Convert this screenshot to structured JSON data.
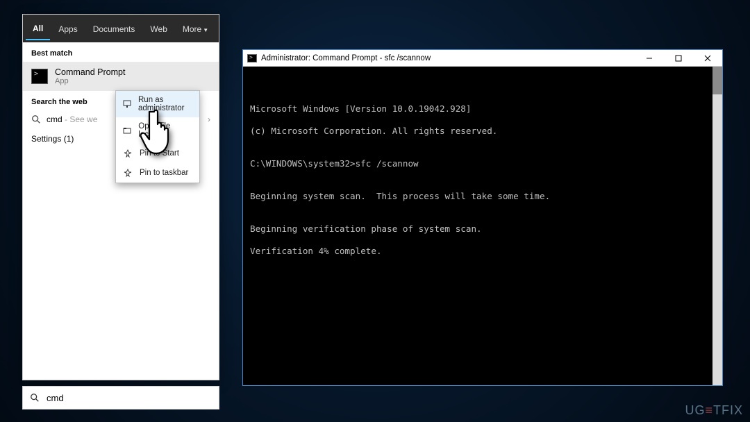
{
  "search_panel": {
    "tabs": {
      "all": "All",
      "apps": "Apps",
      "documents": "Documents",
      "web": "Web",
      "more": "More"
    },
    "best_match_label": "Best match",
    "primary_result": {
      "title": "Command Prompt",
      "subtitle": "App"
    },
    "web_section_label": "Search the web",
    "web_query": "cmd",
    "web_hint": " - See we",
    "settings_row": "Settings (1)"
  },
  "context_menu": {
    "run_admin": "Run as administrator",
    "open_location": "Open file location",
    "pin_start": "Pin to Start",
    "pin_taskbar": "Pin to taskbar"
  },
  "search_box": {
    "value": "cmd"
  },
  "cmd_window": {
    "title": "Administrator: Command Prompt - sfc  /scannow",
    "lines": [
      "Microsoft Windows [Version 10.0.19042.928]",
      "(c) Microsoft Corporation. All rights reserved.",
      "",
      "C:\\WINDOWS\\system32>sfc /scannow",
      "",
      "Beginning system scan.  This process will take some time.",
      "",
      "Beginning verification phase of system scan.",
      "Verification 4% complete."
    ]
  },
  "watermark": {
    "brand_a": "UG",
    "brand_eq": "≡",
    "brand_b": "TFIX"
  }
}
